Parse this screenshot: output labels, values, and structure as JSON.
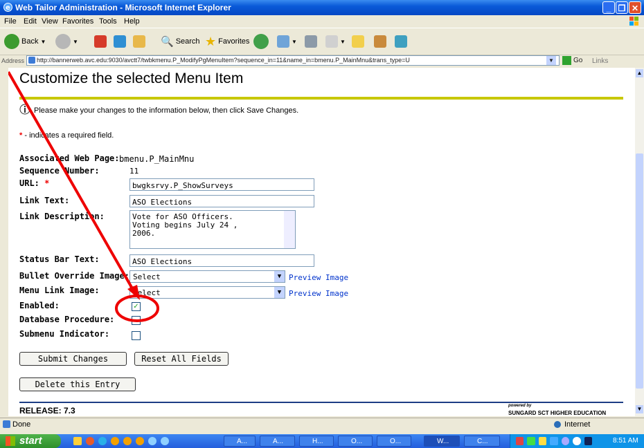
{
  "window": {
    "title": "Web Tailor Administration - Microsoft Internet Explorer"
  },
  "menu": [
    "File",
    "Edit",
    "View",
    "Favorites",
    "Tools",
    "Help"
  ],
  "toolbar": {
    "back": "Back",
    "search": "Search",
    "favorites": "Favorites"
  },
  "address": {
    "label": "Address",
    "url": "http://bannerweb.avc.edu:9030/avctt7/twbkmenu.P_ModifyPgMenuItem?sequence_in=11&name_in=bmenu.P_MainMnu&trans_type=U",
    "go": "Go",
    "links": "Links"
  },
  "page": {
    "title": "Customize the selected Menu Item",
    "info": "Please make your changes to the information below, then click Save Changes.",
    "required_note": "- indicates a required field.",
    "labels": {
      "assoc": "Associated Web Page:",
      "seq": "Sequence Number:",
      "url": "URL:",
      "link_text": "Link Text:",
      "link_desc": "Link Description:",
      "status_bar": "Status Bar Text:",
      "bullet": "Bullet Override Image:",
      "menu_link": "Menu Link Image:",
      "enabled": "Enabled:",
      "db_proc": "Database Procedure:",
      "submenu": "Submenu Indicator:"
    },
    "values": {
      "assoc": "bmenu.P_MainMnu",
      "seq": "11",
      "url": "bwgksrvy.P_ShowSurveys",
      "link_text": "ASO Elections",
      "link_desc": "Vote for ASO Officers.  Voting begins July 24 , 2006.",
      "status_bar": "ASO Elections",
      "bullet": "Select",
      "menu_link": "Select"
    },
    "preview": "Preview Image",
    "buttons": {
      "submit": "Submit Changes",
      "reset": "Reset All Fields",
      "delete": "Delete this Entry"
    },
    "release": "RELEASE: 7.3",
    "powered": "powered by",
    "brand": "SUNGARD SCT HIGHER EDUCATION"
  },
  "status": {
    "left": "Done",
    "zone": "Internet"
  },
  "taskbar": {
    "start": "start",
    "clock": "8:51 AM",
    "tasks": [
      "A...",
      "A...",
      "H...",
      "O...",
      "O...",
      "W...",
      "C..."
    ]
  },
  "colors": {
    "annotation": "#e00000",
    "accent_rule": "#c8c800"
  }
}
